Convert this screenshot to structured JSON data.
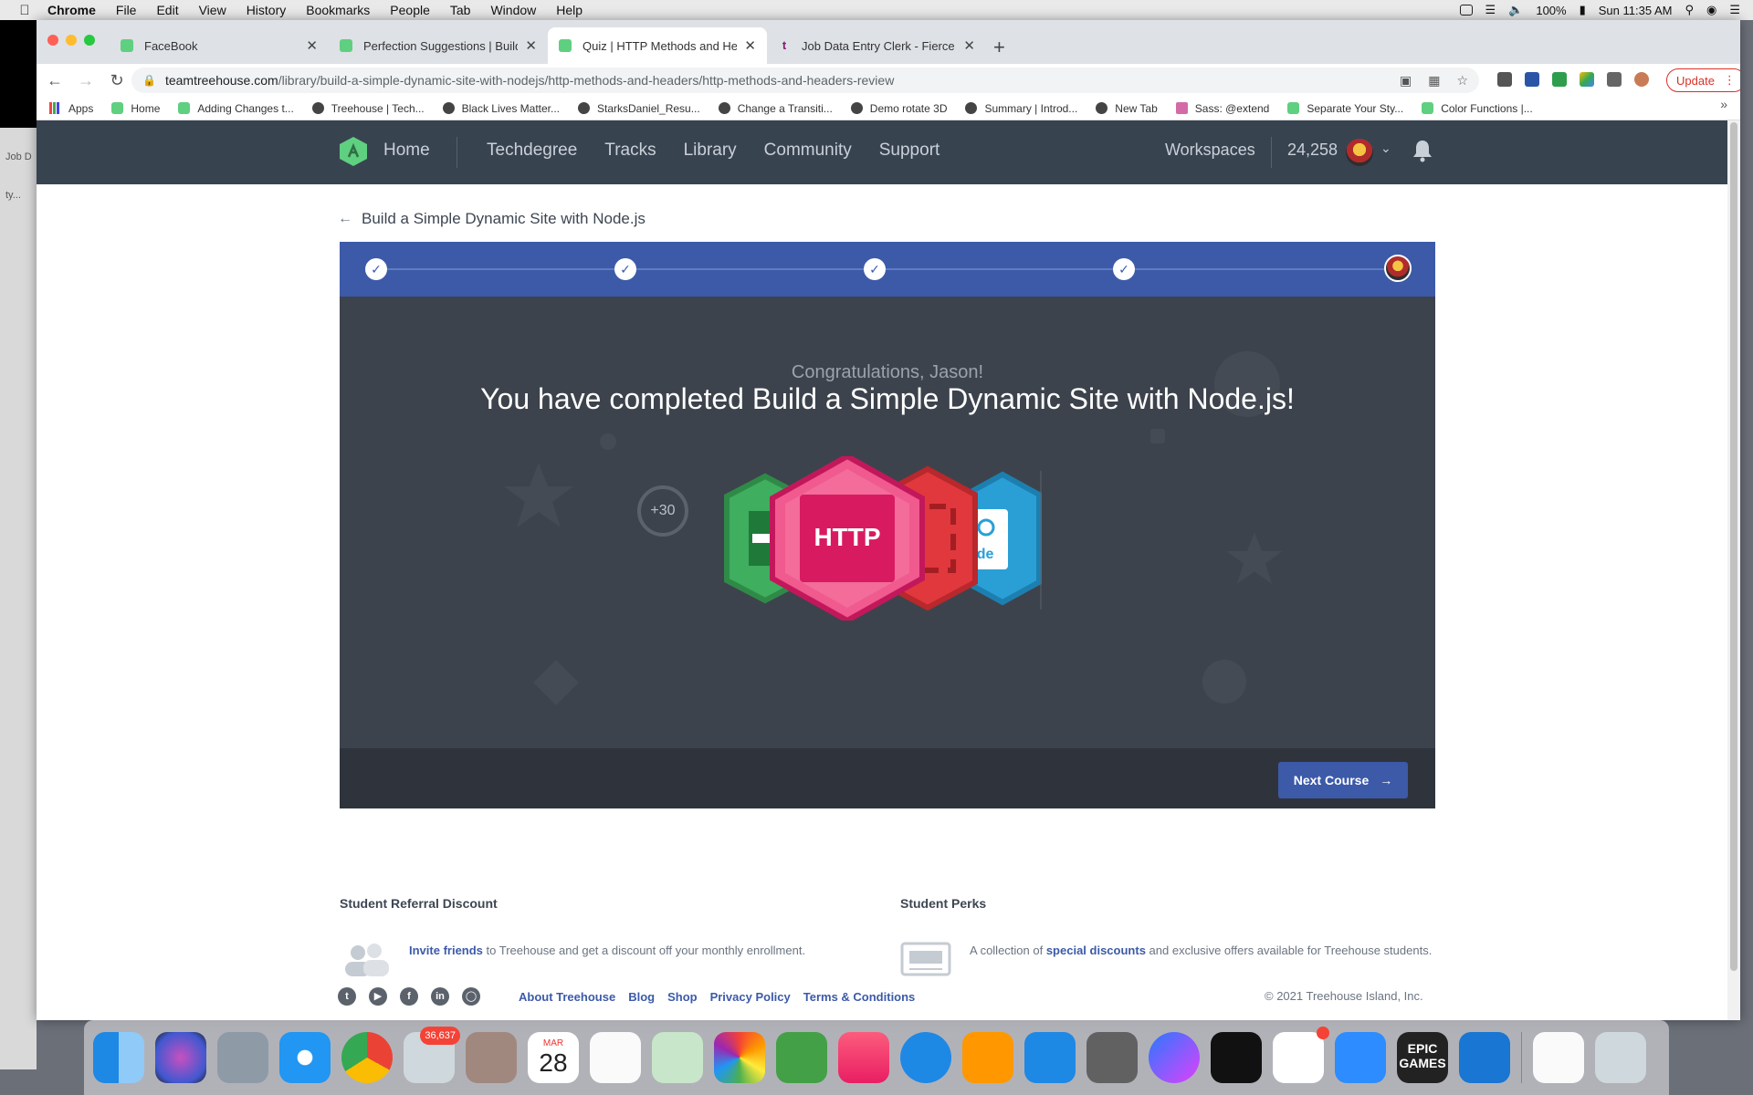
{
  "menubar": {
    "items": [
      "Chrome",
      "File",
      "Edit",
      "View",
      "History",
      "Bookmarks",
      "People",
      "Tab",
      "Window",
      "Help"
    ],
    "battery": "100%",
    "clock": "Sun 11:35 AM"
  },
  "background_window": {
    "tab_text": "Job D",
    "sub_text": "ty..."
  },
  "browser": {
    "tabs": [
      {
        "title": "FaceBook",
        "favicon": "treehouse"
      },
      {
        "title": "Perfection Suggestions | Build",
        "favicon": "treehouse"
      },
      {
        "title": "Quiz | HTTP Methods and Hea",
        "favicon": "treehouse",
        "active": true
      },
      {
        "title": "Job Data Entry Clerk - Fierce F",
        "favicon": "t-icon"
      }
    ],
    "url_host": "teamtreehouse.com",
    "url_path": "/library/build-a-simple-dynamic-site-with-nodejs/http-methods-and-headers/http-methods-and-headers-review",
    "update_label": "Update",
    "bookmarks": [
      "Apps",
      "Home",
      "Adding Changes t...",
      "Treehouse | Tech...",
      "Black Lives Matter...",
      "StarksDaniel_Resu...",
      "Change a Transiti...",
      "Demo rotate 3D",
      "Summary | Introd...",
      "New Tab",
      "Sass: @extend",
      "Separate Your Sty...",
      "Color Functions |..."
    ],
    "bookmarks_more": "»"
  },
  "site": {
    "nav": {
      "home": "Home",
      "links": [
        "Techdegree",
        "Tracks",
        "Library",
        "Community",
        "Support"
      ],
      "workspaces": "Workspaces",
      "points": "24,258"
    },
    "breadcrumb": "Build a Simple Dynamic Site with Node.js",
    "progress": {
      "completed_steps": 4,
      "total_steps": 5
    },
    "congrats": "Congratulations, Jason!",
    "headline": "You have completed Build a Simple Dynamic Site with Node.js!",
    "points_earned": "+30",
    "badges": {
      "http_label": "HTTP",
      "node_label": "ode"
    },
    "next_button": "Next Course",
    "footer": {
      "referral_heading": "Student Referral Discount",
      "referral_link": "Invite friends",
      "referral_text": " to Treehouse and get a discount off your monthly enrollment.",
      "perks_heading": "Student Perks",
      "perks_prefix": "A collection of ",
      "perks_link": "special discounts",
      "perks_text": " and exclusive offers available for Treehouse students.",
      "links": [
        "About Treehouse",
        "Blog",
        "Shop",
        "Privacy Policy",
        "Terms & Conditions"
      ],
      "copyright": "© 2021 Treehouse Island, Inc."
    }
  },
  "dock": {
    "mail_badge": "36,637",
    "calendar_month": "MAR",
    "calendar_day": "28",
    "epic_label": "EPIC GAMES"
  },
  "colors": {
    "nav_bg": "#384350",
    "progress_blue": "#3c5aa8",
    "stage_bg": "#3d434c",
    "badge_green": "#3fae5e",
    "badge_pink": "#e2336f",
    "badge_red": "#e0383d",
    "badge_blue": "#2a9fd6"
  }
}
